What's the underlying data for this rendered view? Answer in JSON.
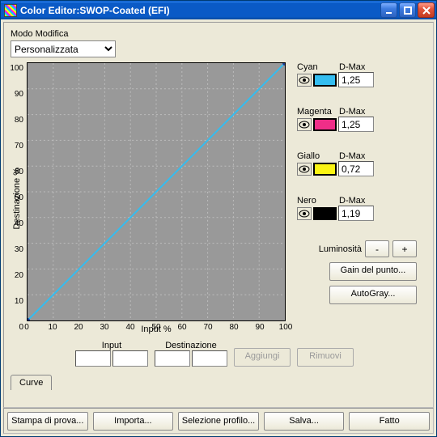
{
  "window": {
    "title": "Color Editor:SWOP-Coated (EFI)"
  },
  "mode": {
    "label": "Modo Modifica",
    "value": "Personalizzata"
  },
  "chart_data": {
    "type": "line",
    "x": [
      0,
      100
    ],
    "y": [
      0,
      100
    ],
    "title": "",
    "xlabel": "Input %",
    "ylabel": "Destinazione %",
    "xlim": [
      0,
      100
    ],
    "ylim": [
      0,
      100
    ],
    "ticks": [
      0,
      10,
      20,
      30,
      40,
      50,
      60,
      70,
      80,
      90,
      100
    ],
    "grid": true
  },
  "channels": {
    "cyan": {
      "name": "Cyan",
      "dmax_label": "D-Max",
      "dmax": "1,25",
      "color": "#34bdf0"
    },
    "magenta": {
      "name": "Magenta",
      "dmax_label": "D-Max",
      "dmax": "1,25",
      "color": "#ef2e88"
    },
    "yellow": {
      "name": "Giallo",
      "dmax_label": "D-Max",
      "dmax": "0,72",
      "color": "#fbf413"
    },
    "black": {
      "name": "Nero",
      "dmax_label": "D-Max",
      "dmax": "1,19",
      "color": "#000000"
    }
  },
  "luminosity": {
    "label": "Luminosità",
    "minus": "-",
    "plus": "+"
  },
  "buttons": {
    "dotgain": "Gain del punto...",
    "autogray": "AutoGray..."
  },
  "input_dest": {
    "input_label": "Input",
    "dest_label": "Destinazione",
    "add": "Aggiungi",
    "remove": "Rimuovi"
  },
  "tab": {
    "curve": "Curve"
  },
  "bottom": {
    "proof": "Stampa di prova...",
    "import": "Importa...",
    "select": "Selezione profilo...",
    "save": "Salva...",
    "done": "Fatto"
  }
}
